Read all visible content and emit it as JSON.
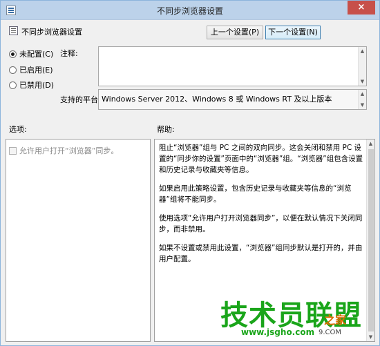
{
  "window": {
    "title": "不同步浏览器设置",
    "close_glyph": "×"
  },
  "policy": {
    "name": "不同步浏览器设置"
  },
  "nav": {
    "prev_label": "上一个设置(P)",
    "next_label": "下一个设置(N)"
  },
  "state_options": [
    {
      "label": "未配置(C)",
      "checked": true
    },
    {
      "label": "已启用(E)",
      "checked": false
    },
    {
      "label": "已禁用(D)",
      "checked": false
    }
  ],
  "comment": {
    "label": "注释:",
    "value": ""
  },
  "platform": {
    "label": "支持的平台:",
    "value": "Windows Server 2012、Windows 8 或 Windows RT 及以上版本"
  },
  "options": {
    "label": "选项:",
    "checkbox_label": "允许用户打开“浏览器”同步。",
    "checkbox_checked": false
  },
  "help": {
    "label": "帮助:",
    "paragraphs": [
      "阻止“浏览器”组与 PC 之间的双向同步。这会关闭和禁用 PC 设置的“同步你的设置”页面中的“浏览器”组。“浏览器”组包含设置和历史记录与收藏夹等信息。",
      "如果启用此策略设置，包含历史记录与收藏夹等信息的“浏览器”组将不能同步。",
      "使用选项“允许用户打开浏览器同步”，以便在默认情况下关闭同步，而非禁用。",
      "如果不设置或禁用此设置，“浏览器”组同步默认是打开的，并由用户配置。"
    ]
  },
  "watermark": {
    "main": "技术员联盟",
    "url": "www.jsgho.com",
    "badge": "之家",
    "sub": "9.COM"
  },
  "colors": {
    "titlebar": "#bcd2ea",
    "close": "#c7504a",
    "watermark_green": "#1aa51a"
  }
}
